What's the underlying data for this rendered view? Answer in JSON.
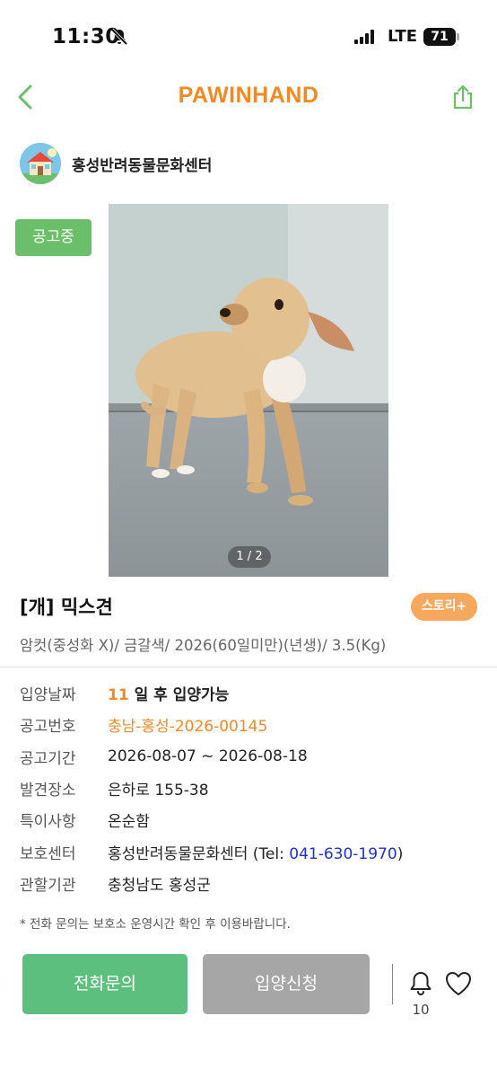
{
  "status_bar": {
    "time": "11:30",
    "network": "LTE",
    "battery": "71"
  },
  "header": {
    "brand": "PAWINHAND"
  },
  "shelter": {
    "name": "홍성반려동물문화센터"
  },
  "badge": {
    "label": "공고중"
  },
  "photo": {
    "pager": "1 / 2"
  },
  "pet": {
    "title": "[개] 믹스견",
    "story_label": "스토리+",
    "description": "암컷(중성화 X)/ 금갈색/ 2026(60일미만)(년생)/ 3.5(Kg)"
  },
  "info": {
    "adoption_date": {
      "label": "입양날짜",
      "days": "11",
      "suffix": " 일 후 입양가능"
    },
    "notice_no": {
      "label": "공고번호",
      "value": "충남-홍성-2026-00145"
    },
    "notice_period": {
      "label": "공고기간",
      "value": "2026-08-07 ~ 2026-08-18"
    },
    "found_place": {
      "label": "발견장소",
      "value": "은하로 155-38"
    },
    "special_notes": {
      "label": "특이사항",
      "value": "온순함"
    },
    "care_center": {
      "label": "보호센터",
      "value_prefix": "홍성반려동물문화센터 (Tel: ",
      "tel": "041-630-1970",
      "value_suffix": ")"
    },
    "authority": {
      "label": "관할기관",
      "value": "충청남도 홍성군"
    }
  },
  "footnote": "* 전화 문의는 보호소 운영시간 확인 후 이용바랍니다.",
  "actions": {
    "call_label": "전화문의",
    "adopt_label": "입양신청",
    "bell_count": "10"
  },
  "colors": {
    "brand": "#f08a24",
    "green": "#5cbf7d",
    "badge_green": "#6cbf6a",
    "disabled_gray": "#a6a6a6",
    "story_orange": "#f7a85c",
    "tel_blue": "#1d2fd0"
  },
  "icons": [
    "bell-off-icon",
    "signal-icon",
    "battery-icon",
    "back-arrow-icon",
    "share-icon",
    "shelter-house-icon",
    "bell-icon",
    "heart-icon"
  ]
}
